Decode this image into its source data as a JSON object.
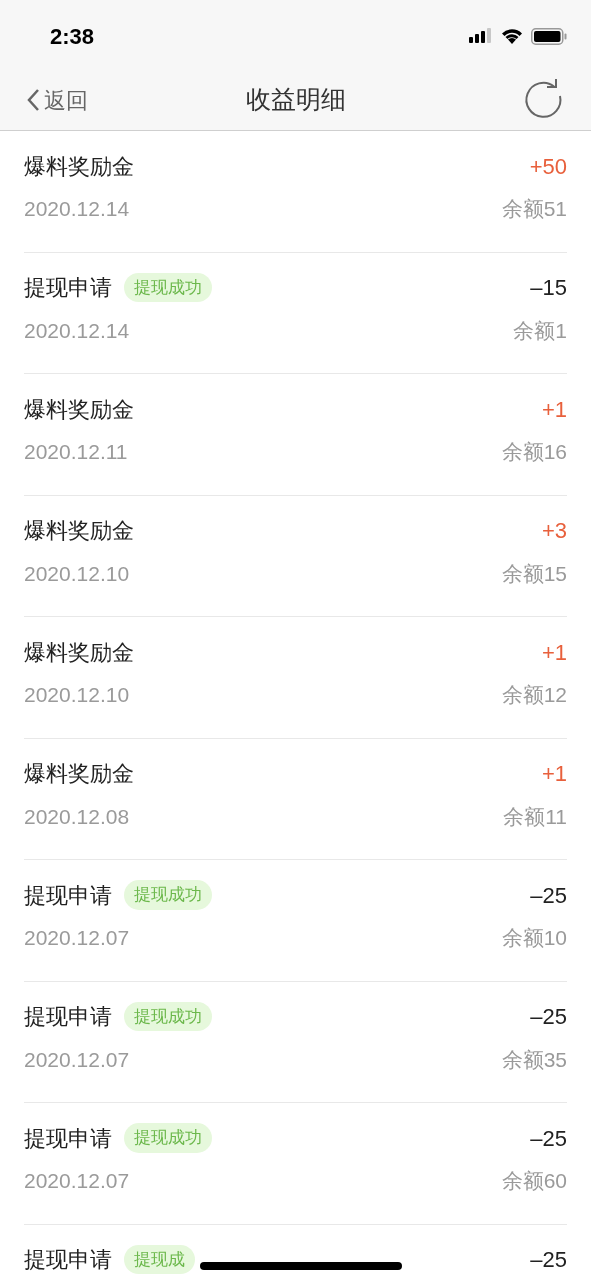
{
  "status_bar": {
    "time": "2:38"
  },
  "nav": {
    "back": "返回",
    "title": "收益明细"
  },
  "rows": [
    {
      "kind": "reward",
      "title": "爆料奖励金",
      "amount": "+50",
      "date": "2020.12.14",
      "balance": "余额51"
    },
    {
      "kind": "withdraw",
      "title": "提现申请",
      "badge": "提现成功",
      "amount": "–15",
      "date": "2020.12.14",
      "balance": "余额1"
    },
    {
      "kind": "reward",
      "title": "爆料奖励金",
      "amount": "+1",
      "date": "2020.12.11",
      "balance": "余额16"
    },
    {
      "kind": "reward",
      "title": "爆料奖励金",
      "amount": "+3",
      "date": "2020.12.10",
      "balance": "余额15"
    },
    {
      "kind": "reward",
      "title": "爆料奖励金",
      "amount": "+1",
      "date": "2020.12.10",
      "balance": "余额12"
    },
    {
      "kind": "reward",
      "title": "爆料奖励金",
      "amount": "+1",
      "date": "2020.12.08",
      "balance": "余额11"
    },
    {
      "kind": "withdraw",
      "title": "提现申请",
      "badge": "提现成功",
      "amount": "–25",
      "date": "2020.12.07",
      "balance": "余额10"
    },
    {
      "kind": "withdraw",
      "title": "提现申请",
      "badge": "提现成功",
      "amount": "–25",
      "date": "2020.12.07",
      "balance": "余额35"
    },
    {
      "kind": "withdraw",
      "title": "提现申请",
      "badge": "提现成功",
      "amount": "–25",
      "date": "2020.12.07",
      "balance": "余额60"
    },
    {
      "kind": "withdraw",
      "title": "提现申请",
      "badge": "提现成",
      "amount": "–25"
    }
  ]
}
